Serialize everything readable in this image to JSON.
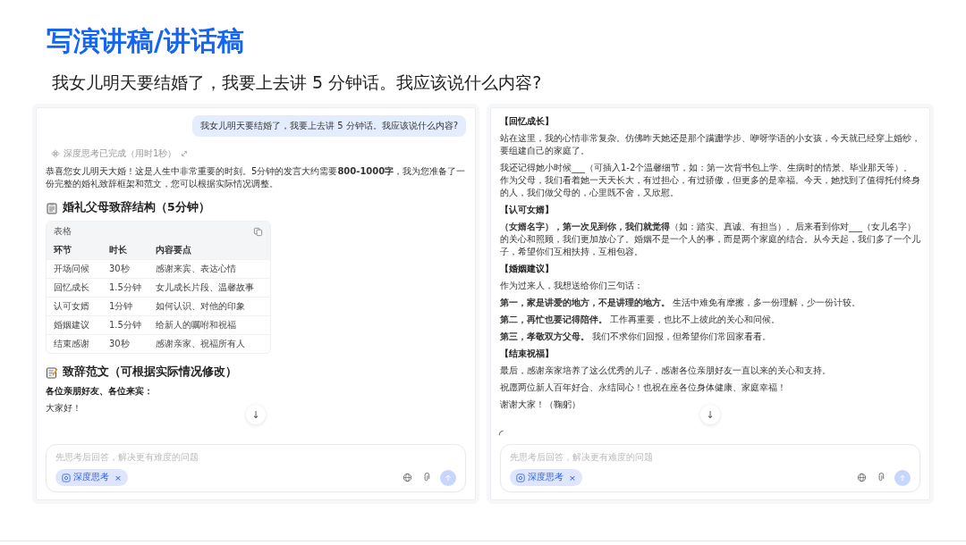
{
  "title": "写演讲稿/讲话稿",
  "question": "我女儿明天要结婚了，我要上去讲 5 分钟话。我应该说什么内容?",
  "panels": [
    {
      "user_message": "我女儿明天要结婚了，我要上去讲 5 分钟话。我应该说什么内容?",
      "thinking_status": "深度思考已完成（用时1秒）",
      "blocks": [
        {
          "kind": "paragraph",
          "text": "恭喜您女儿明天大婚！这是人生中非常重要的时刻。5分钟的发言大约需要**800-1000字**，我为您准备了一份完整的婚礼致辞框架和范文，您可以根据实际情况调整。"
        },
        {
          "kind": "heading",
          "text": "婚礼父母致辞结构（5分钟）"
        },
        {
          "kind": "table",
          "caption": "表格",
          "columns": [
            "环节",
            "时长",
            "内容要点"
          ],
          "rows": [
            [
              "开场问候",
              "30秒",
              "感谢来宾、表达心情"
            ],
            [
              "回忆成长",
              "1.5分钟",
              "女儿成长片段、温馨故事"
            ],
            [
              "认可女婿",
              "1分钟",
              "如何认识、对他的印象"
            ],
            [
              "婚姻建议",
              "1.5分钟",
              "给新人的嘱咐和祝福"
            ],
            [
              "结束感谢",
              "30秒",
              "感谢亲家、祝福所有人"
            ]
          ]
        },
        {
          "kind": "heading",
          "text": "致辞范文（可根据实际情况修改）"
        },
        {
          "kind": "bold_paragraph",
          "text": "各位亲朋好友、各位来宾："
        },
        {
          "kind": "paragraph",
          "text": "大家好！"
        }
      ],
      "scroll_button": "↓",
      "input": {
        "placeholder": "先思考后回答，解决更有难度的问题",
        "chip": "深度思考",
        "chip_close": "×",
        "chip_on": true,
        "send_disabled": true
      }
    },
    {
      "loading": true,
      "blocks": [
        {
          "kind": "section",
          "text": "【回忆成长】"
        },
        {
          "kind": "paragraph",
          "text": "站在这里，我的心情非常复杂。仿佛昨天她还是那个蹒跚学步、咿呀学语的小女孩，今天就已经穿上婚纱，要组建自己的家庭了。"
        },
        {
          "kind": "paragraph",
          "text": "我还记得她小时候___（可插入1-2个温馨细节，如：第一次背书包上学、生病时的情景、毕业那天等）。作为父母，我们看着她一天天长大，有过担心，有过骄傲，但更多的是幸福。今天，她找到了值得托付终身的人，我们做父母的，心里既不舍，又欣慰。"
        },
        {
          "kind": "section",
          "text": "【认可女婿】"
        },
        {
          "kind": "paragraph",
          "text": "**（女婿名字），第一次见到你，我们就觉得**（如：踏实、真诚、有担当）。后来看到你对___（女儿名字）的关心和照顾，我们更加放心了。婚姻不是一个人的事，而是两个家庭的结合。从今天起，我们多了一个儿子，希望你们互相扶持，互相包容。"
        },
        {
          "kind": "section",
          "text": "【婚姻建议】"
        },
        {
          "kind": "paragraph",
          "text": "作为过来人，我想送给你们三句话："
        },
        {
          "kind": "paragraph",
          "text": "**第一，家是讲爱的地方，不是讲理的地方。** 生活中难免有摩擦，多一份理解，少一份计较。"
        },
        {
          "kind": "paragraph",
          "text": "**第二，再忙也要记得陪伴。** 工作再重要，也比不上彼此的关心和问候。"
        },
        {
          "kind": "paragraph",
          "text": "**第三，孝敬双方父母。** 我们不求你们回报，但希望你们常回家看看。"
        },
        {
          "kind": "section",
          "text": "【结束祝福】"
        },
        {
          "kind": "paragraph",
          "text": "最后，感谢亲家培养了这么优秀的儿子，感谢各位亲朋好友一直以来的关心和支持。"
        },
        {
          "kind": "paragraph",
          "text": "祝愿两位新人百年好合、永结同心！也祝在座各位身体健康、家庭幸福！"
        },
        {
          "kind": "paragraph",
          "text": "谢谢大家！（鞠躬）"
        }
      ],
      "scroll_button": "↓",
      "input": {
        "placeholder": "先思考后回答，解决更有难度的问题",
        "chip": "深度思考",
        "chip_close": "×",
        "chip_on": true,
        "send_disabled": true
      }
    }
  ]
}
